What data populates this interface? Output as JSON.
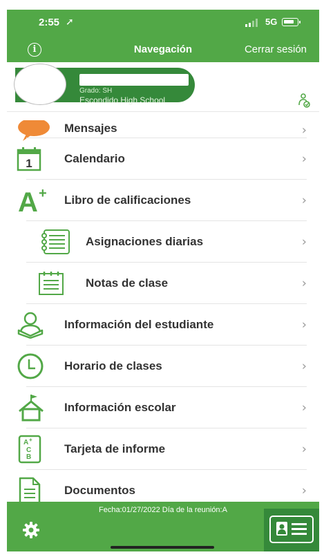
{
  "status": {
    "time": "2:55",
    "location_glyph": "➚",
    "network": "5G"
  },
  "nav": {
    "info_glyph": "i",
    "title": "Navegación",
    "logout": "Cerrar sesión"
  },
  "profile": {
    "grade": "Grado: SH",
    "school": "Escondido High School"
  },
  "menu": [
    {
      "label": "Mensajes",
      "icon": "chat-bubble-icon"
    },
    {
      "label": "Calendario",
      "icon": "calendar-icon"
    },
    {
      "label": "Libro de calificaciones",
      "icon": "a-plus-icon"
    },
    {
      "label": "Asignaciones diarias",
      "icon": "checklist-icon"
    },
    {
      "label": "Notas de clase",
      "icon": "notepad-icon"
    },
    {
      "label": "Información del estudiante",
      "icon": "student-reading-icon"
    },
    {
      "label": "Horario de clases",
      "icon": "clock-icon"
    },
    {
      "label": "Información escolar",
      "icon": "school-house-icon"
    },
    {
      "label": "Tarjeta de informe",
      "icon": "report-card-icon"
    },
    {
      "label": "Documentos",
      "icon": "document-icon"
    }
  ],
  "calendar_day": "1",
  "aplus": {
    "letter": "A",
    "plus": "+"
  },
  "report_card": {
    "a": "A",
    "plus": "+",
    "c": "C",
    "b": "B"
  },
  "chevron": "›",
  "footer": {
    "date_text": "Fecha:01/27/2022 Día de la reunión:A"
  },
  "colors": {
    "brand_green": "#52a847",
    "dark_green": "#35893a",
    "chat_orange": "#ef8a37"
  }
}
